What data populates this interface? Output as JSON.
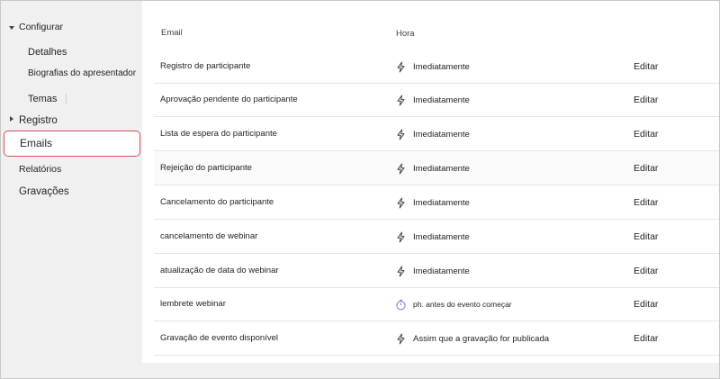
{
  "sidebar": {
    "configure": "Configurar",
    "details": "Detalhes",
    "bios": "Biografias do apresentador",
    "themes": "Temas",
    "registration": "Registro",
    "emails": "Emails",
    "reports": "Relatórios",
    "recordings": "Gravações"
  },
  "table": {
    "headers": {
      "email": "Email",
      "time": "Hora"
    },
    "edit_label": "Editar",
    "rows": [
      {
        "email": "Registro de participante",
        "time": "Imediatamente",
        "icon": "lightning-icon"
      },
      {
        "email": "Aprovação pendente do participante",
        "time": "Imediatamente",
        "icon": "lightning-icon"
      },
      {
        "email": "Lista de espera do participante",
        "time": "Imediatamente",
        "icon": "lightning-icon"
      },
      {
        "email": "Rejeição do participante",
        "time": "Imediatamente",
        "icon": "lightning-icon"
      },
      {
        "email": "Cancelamento do participante",
        "time": "Imediatamente",
        "icon": "lightning-icon"
      },
      {
        "email": "cancelamento de webinar",
        "time": "Imediatamente",
        "icon": "lightning-icon"
      },
      {
        "email": "atualização de data do webinar",
        "time": "Imediatamente",
        "icon": "lightning-icon"
      },
      {
        "email": "lembrete webinar",
        "time": "ph. antes do evento começar",
        "icon": "stopwatch-icon"
      },
      {
        "email": "Gravação de evento disponível",
        "time": "Assim que a gravação for publicada",
        "icon": "lightning-icon"
      }
    ]
  },
  "colors": {
    "selected_border": "#e0495a",
    "stopwatch": "#8b7fd6"
  }
}
